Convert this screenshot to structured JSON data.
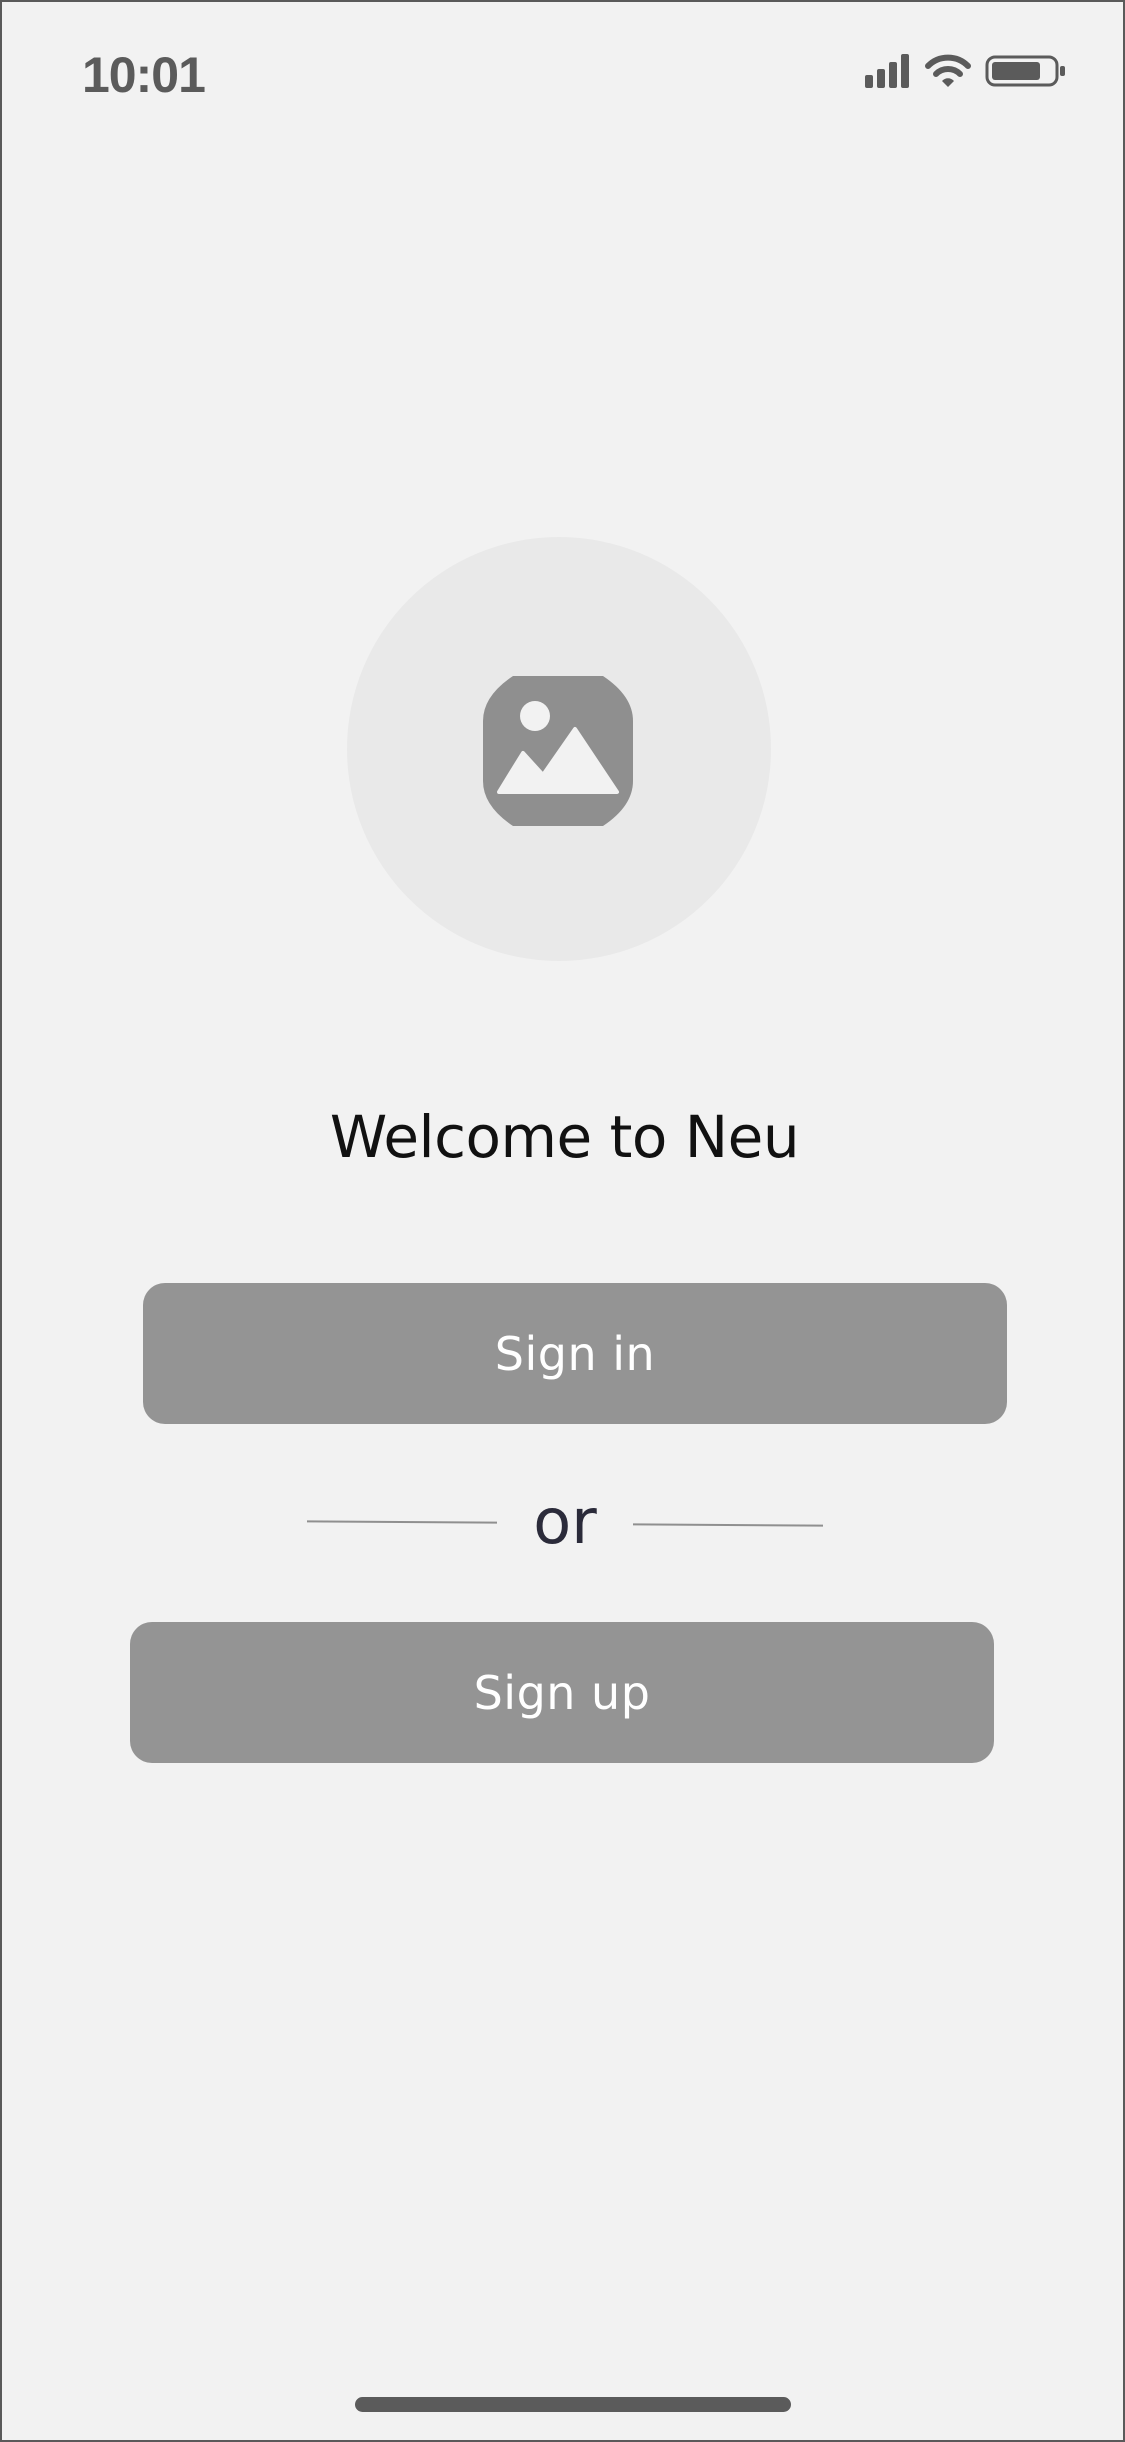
{
  "status_bar": {
    "time": "10:01",
    "icons": [
      "cellular-signal-icon",
      "wifi-icon",
      "battery-icon"
    ],
    "battery_level": 0.8
  },
  "hero": {
    "icon": "image-placeholder-icon"
  },
  "welcome": {
    "title": "Welcome to Neu"
  },
  "auth": {
    "sign_in_label": "Sign in",
    "divider_text": "or",
    "sign_up_label": "Sign up"
  },
  "colors": {
    "background": "#f2f2f2",
    "button": "#949494",
    "button_text": "#ffffff",
    "hero_circle": "#e9e9e9",
    "icon": "#8f8f8f"
  }
}
